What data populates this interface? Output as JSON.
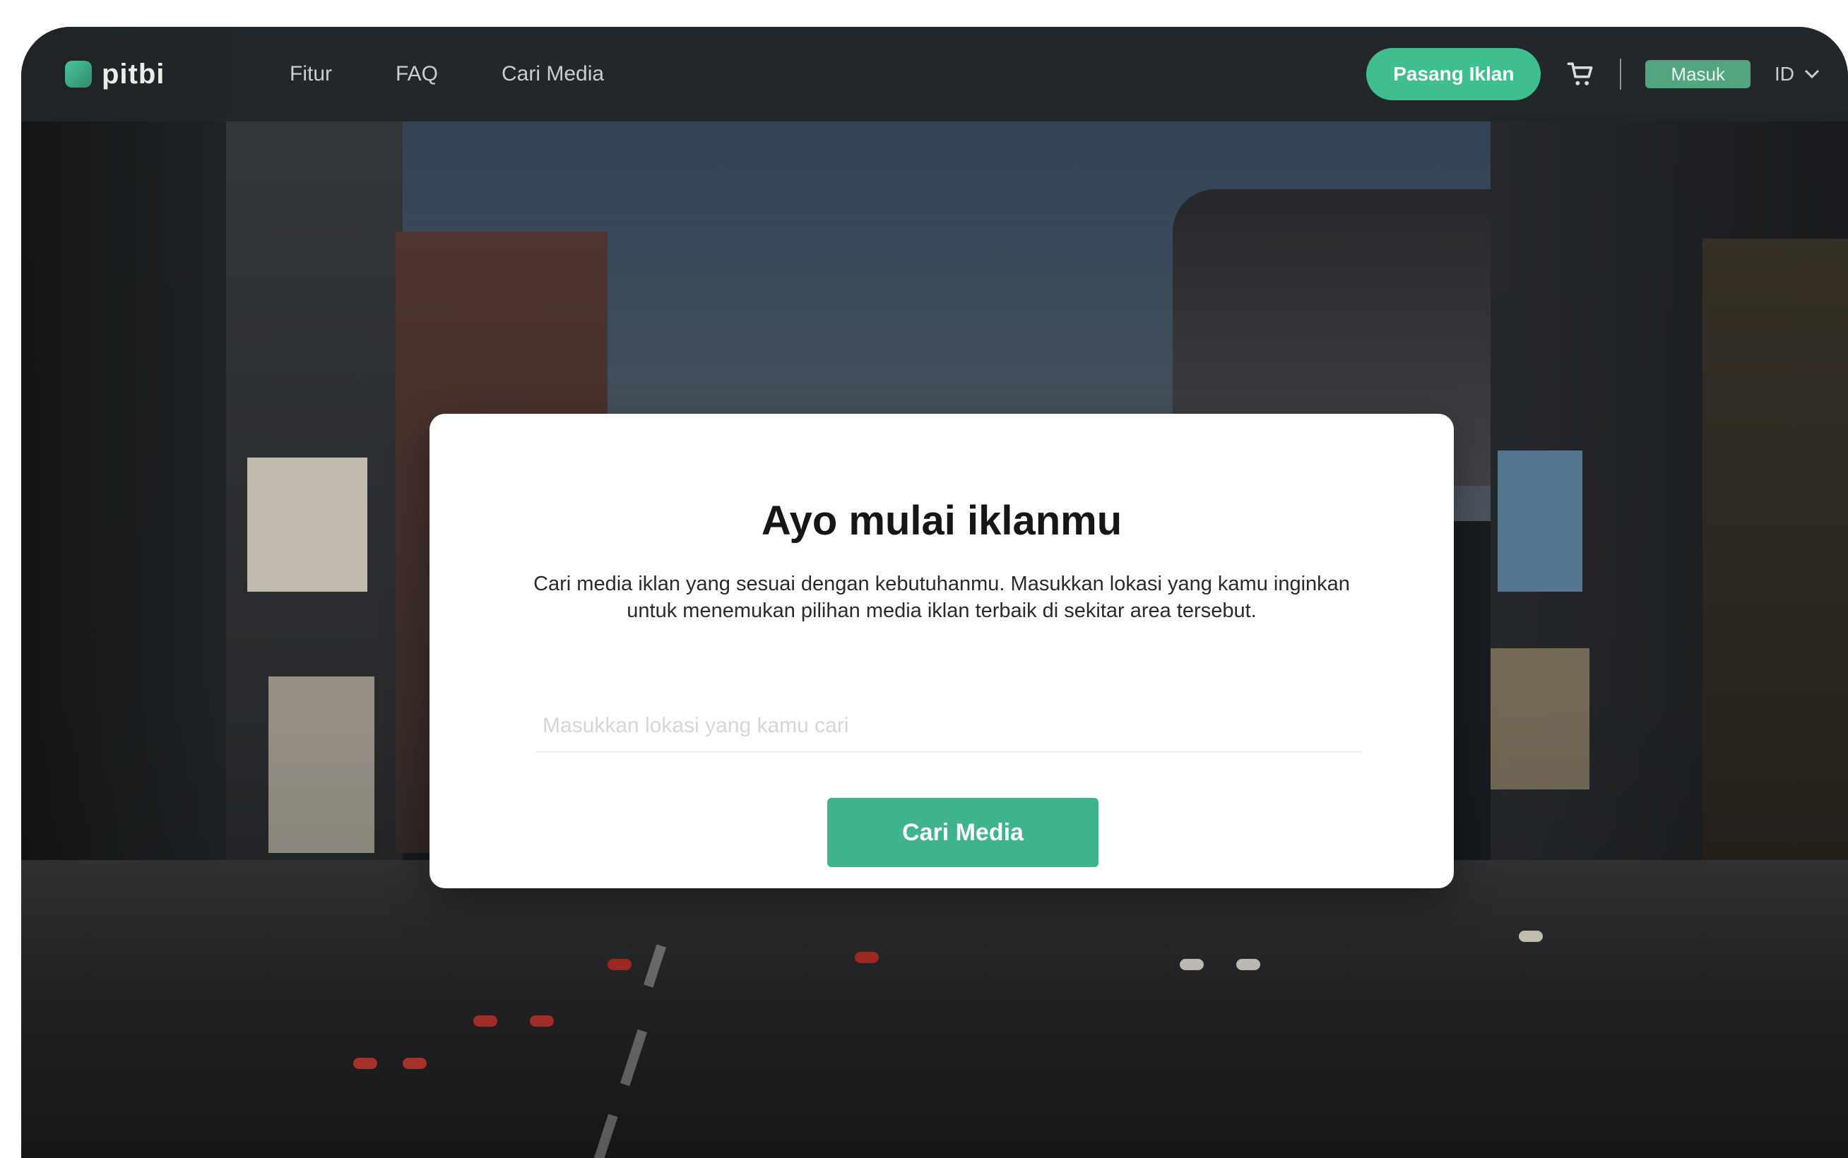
{
  "navbar": {
    "logo_text": "pitbi",
    "links": [
      "Fitur",
      "FAQ",
      "Cari Media"
    ],
    "cta_label": "Pasang Iklan",
    "login_label": "Masuk",
    "language_label": "ID"
  },
  "modal": {
    "title": "Ayo mulai iklanmu",
    "description": "Cari media iklan yang sesuai dengan kebutuhanmu. Masukkan lokasi yang kamu inginkan untuk menemukan pilihan media iklan terbaik di sekitar area tersebut.",
    "input_placeholder": "Masukkan lokasi yang kamu cari",
    "button_label": "Cari Media"
  },
  "icons": {
    "cart": "cart-icon",
    "language_chevron": "chevron-down-icon"
  },
  "colors": {
    "accent": "#3fbf8e",
    "navbar": "#212628",
    "modal_bg": "#ffffff"
  }
}
